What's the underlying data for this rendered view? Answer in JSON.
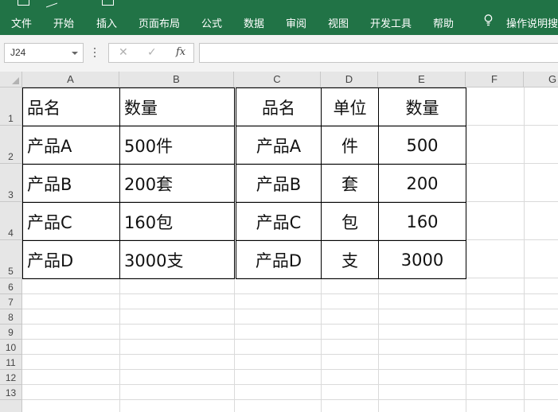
{
  "ribbon": {
    "tabs": [
      "文件",
      "开始",
      "插入",
      "页面布局",
      "公式",
      "数据",
      "审阅",
      "视图",
      "开发工具",
      "帮助"
    ],
    "tell_me": "操作说明搜"
  },
  "formula_bar": {
    "name_box": "J24",
    "cancel_icon": "✕",
    "enter_icon": "✓",
    "fx_label": "fx",
    "formula_value": ""
  },
  "sheet": {
    "columns": [
      "A",
      "B",
      "C",
      "D",
      "E",
      "F",
      "G"
    ],
    "rows": [
      "1",
      "2",
      "3",
      "4",
      "5",
      "6",
      "7",
      "8",
      "9",
      "10",
      "11",
      "12",
      "13"
    ],
    "left_table": {
      "headers": [
        "品名",
        "数量"
      ],
      "rows": [
        [
          "产品A",
          "500件"
        ],
        [
          "产品B",
          "200套"
        ],
        [
          "产品C",
          "160包"
        ],
        [
          "产品D",
          "3000支"
        ]
      ]
    },
    "right_table": {
      "headers": [
        "品名",
        "单位",
        "数量"
      ],
      "rows": [
        [
          "产品A",
          "件",
          "500"
        ],
        [
          "产品B",
          "套",
          "200"
        ],
        [
          "产品C",
          "包",
          "160"
        ],
        [
          "产品D",
          "支",
          "3000"
        ]
      ]
    }
  },
  "colors": {
    "ribbon_green": "#217346",
    "header_gray": "#e6e6e6",
    "gridline": "#dadada"
  }
}
